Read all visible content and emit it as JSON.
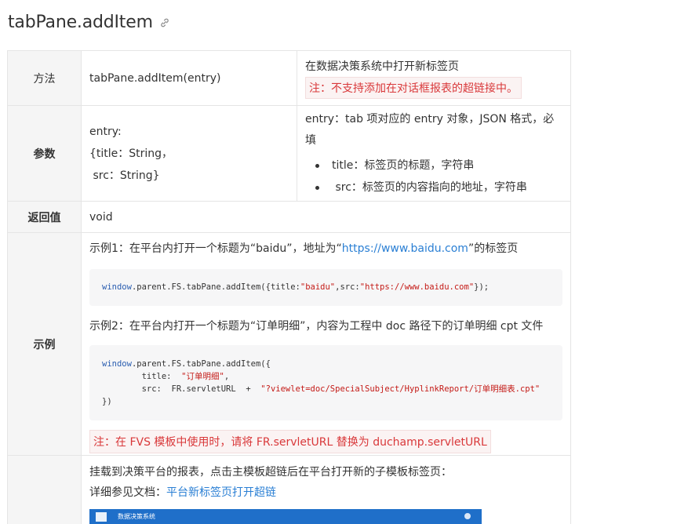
{
  "title": "tabPane.addItem",
  "method": {
    "label": "方法",
    "signature": "tabPane.addItem(entry)",
    "desc": "在数据决策系统中打开新标签页",
    "note": "注：不支持添加在对话框报表的超链接中。"
  },
  "params": {
    "label": "参数",
    "line1": "entry:",
    "line2": "{title：String，",
    "line3": " src：String}",
    "desc_line1": "entry：tab 项对应的 entry 对象，JSON 格式，必",
    "desc_line2": "填",
    "bullets": [
      "title：标签页的标题，字符串",
      " src：标签页的内容指向的地址，字符串"
    ]
  },
  "returns": {
    "label": "返回值",
    "value": "void"
  },
  "example": {
    "label": "示例",
    "ex1_prefix": "示例1：在平台内打开一个标题为“baidu”，地址为“",
    "ex1_link": "https://www.baidu.com",
    "ex1_suffix": "”的标签页",
    "code1": {
      "kw": "window",
      "a": ".parent.FS.tabPane.addItem({title:",
      "s1": "\"baidu\"",
      "b": ",src:",
      "s2": "\"https://www.baidu.com\"",
      "c": "});"
    },
    "ex2_text": "示例2：在平台内打开一个标题为“订单明细”，内容为工程中 doc 路径下的订单明细 cpt 文件",
    "code2": {
      "kw": "window",
      "l1": ".parent.FS.tabPane.addItem({",
      "l2a": "        title:  ",
      "l2s": "\"订单明细\"",
      "l2b": ",",
      "l3a": "        src:  FR.servletURL  +  ",
      "l3s": "\"?viewlet=doc/SpecialSubject/HyplinkReport/订单明细表.cpt\"",
      "l4": "})"
    },
    "note": "注：在 FVS 模板中使用时，请将 FR.servletURL 替换为 duchamp.servletURL"
  },
  "last": {
    "line1": "挂载到决策平台的报表，点击主模板超链后在平台打开新的子模板标签页：",
    "line2_prefix": "详细参见文档：",
    "line2_link": "平台新标签页打开超链",
    "shot_title": "数据决策系统"
  },
  "colors": {
    "link": "#2a7fd4",
    "note_red": "#d9383a",
    "key_bg": "#f5f5f5"
  }
}
